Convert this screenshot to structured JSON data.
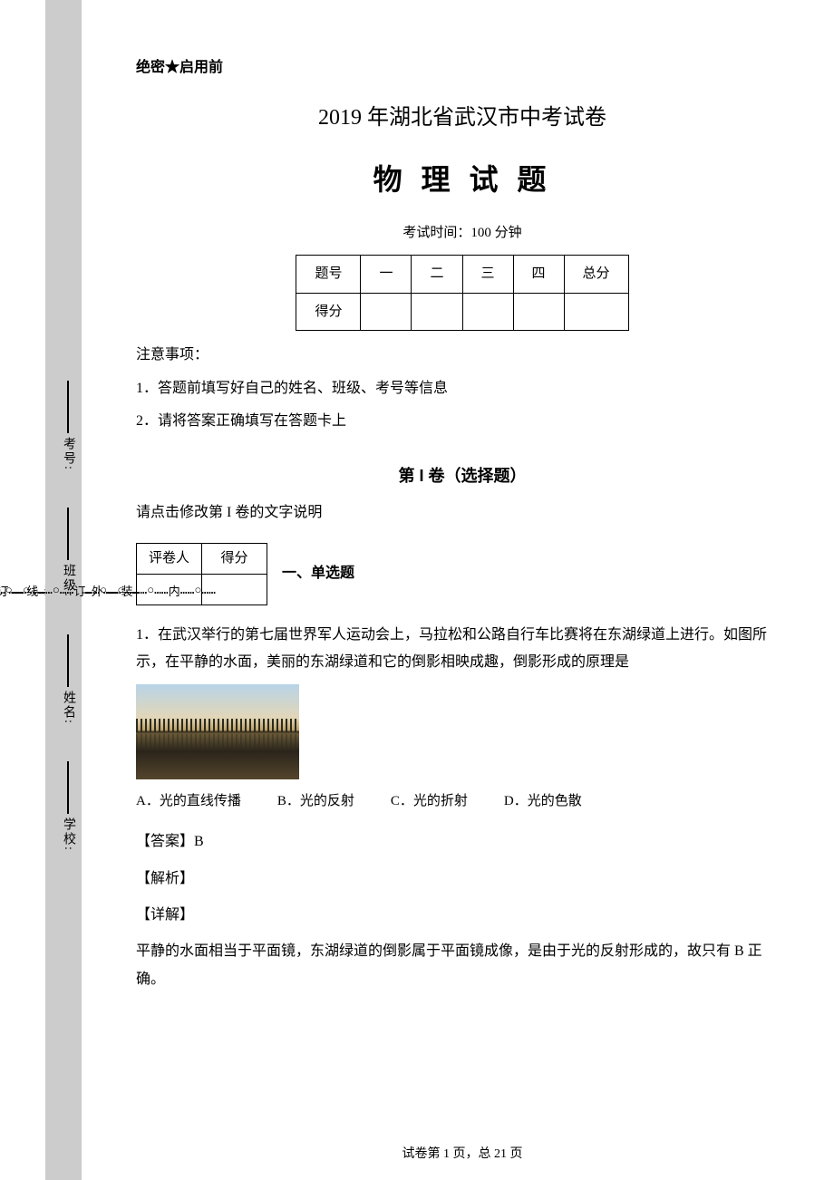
{
  "margins": {
    "outer_chars": [
      "外",
      "装",
      "订",
      "线"
    ],
    "inner_chars": [
      "内",
      "装",
      "订",
      "线"
    ],
    "dot_seq": "……",
    "circle": "○"
  },
  "info_fields": {
    "school": "学校:",
    "name": "姓名:",
    "class": "班级:",
    "examno": "考号:"
  },
  "header": {
    "secret": "绝密★启用前",
    "title1": "2019 年湖北省武汉市中考试卷",
    "title2": "物 理 试 题",
    "time": "考试时间：100 分钟"
  },
  "score_table": {
    "h_num": "题号",
    "h_score": "得分",
    "cols": [
      "一",
      "二",
      "三",
      "四",
      "总分"
    ]
  },
  "notices": {
    "heading": "注意事项：",
    "n1": "1．答题前填写好自己的姓名、班级、考号等信息",
    "n2": "2．请将答案正确填写在答题卡上"
  },
  "section1": {
    "title": "第 I 卷（选择题）",
    "instr": "请点击修改第 I 卷的文字说明"
  },
  "grader": {
    "h1": "评卷人",
    "h2": "得分",
    "subtitle": "一、单选题"
  },
  "q1": {
    "text": "1．在武汉举行的第七届世界军人运动会上，马拉松和公路自行车比赛将在东湖绿道上进行。如图所示，在平静的水面，美丽的东湖绿道和它的倒影相映成趣，倒影形成的原理是",
    "options": {
      "a": "A．光的直线传播",
      "b": "B．光的反射",
      "c": "C．光的折射",
      "d": "D．光的色散"
    },
    "answer_label": "【答案】",
    "answer": "B",
    "explain_label": "【解析】",
    "detail_label": "【详解】",
    "explanation": "平静的水面相当于平面镜，东湖绿道的倒影属于平面镜成像，是由于光的反射形成的，故只有 B 正确。"
  },
  "footer": {
    "text": "试卷第 1 页，总 21 页"
  }
}
